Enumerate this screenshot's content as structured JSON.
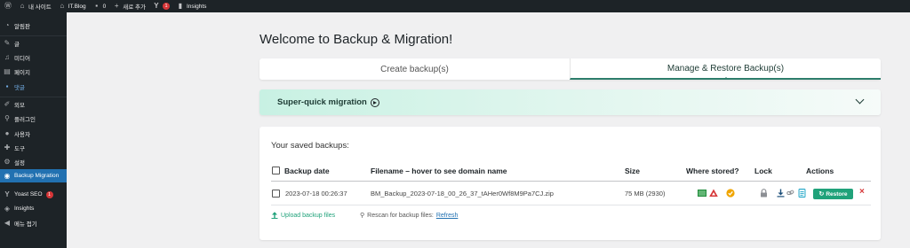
{
  "adminbar": {
    "site_name": "내 사이트",
    "blog": "IT.Blog",
    "comments_count": "0",
    "new_label": "새로 추가",
    "notifications": "1",
    "insights": "Insights"
  },
  "sidebar": {
    "items": [
      {
        "label": "알림판",
        "icon": "dashboard-icon"
      },
      {
        "label": "글",
        "icon": "pin-icon"
      },
      {
        "label": "미디어",
        "icon": "media-icon"
      },
      {
        "label": "페이지",
        "icon": "page-icon"
      },
      {
        "label": "댓글",
        "icon": "comment-icon"
      },
      {
        "label": "외모",
        "icon": "brush-icon"
      },
      {
        "label": "플러그인",
        "icon": "plugin-icon"
      },
      {
        "label": "사용자",
        "icon": "user-icon"
      },
      {
        "label": "도구",
        "icon": "wrench-icon"
      },
      {
        "label": "설정",
        "icon": "settings-icon"
      },
      {
        "label": "Backup Migration",
        "icon": "backup-icon"
      },
      {
        "label": "Yoast SEO",
        "icon": "yoast-icon",
        "badge": "1"
      },
      {
        "label": "Insights",
        "icon": "insights-icon"
      },
      {
        "label": "메뉴 접기",
        "icon": "collapse-icon"
      }
    ]
  },
  "page": {
    "title": "Welcome to Backup & Migration!",
    "tabs": [
      "Create backup(s)",
      "Manage & Restore Backup(s)"
    ],
    "active_tab": 1,
    "migration_label": "Super-quick migration"
  },
  "backups": {
    "saved_label": "Your saved backups:",
    "headers": {
      "date": "Backup date",
      "filename": "Filename – hover to see domain name",
      "size": "Size",
      "stored": "Where stored?",
      "lock": "Lock",
      "actions": "Actions"
    },
    "rows": [
      {
        "date": "2023-07-18 00:26:37",
        "filename": "BM_Backup_2023-07-18_00_26_37_tAHer0Wf8M9Pa7CJ.zip",
        "size": "75 MB (2930)",
        "restore_label": "Restore"
      }
    ],
    "upload_label": "Upload backup files",
    "rescan_label": "Rescan for backup files:",
    "refresh_label": "Refresh"
  },
  "colors": {
    "accent": "#2d7d6b",
    "restore": "#20a27a",
    "wp_blue": "#2271b1",
    "danger": "#d63638"
  }
}
